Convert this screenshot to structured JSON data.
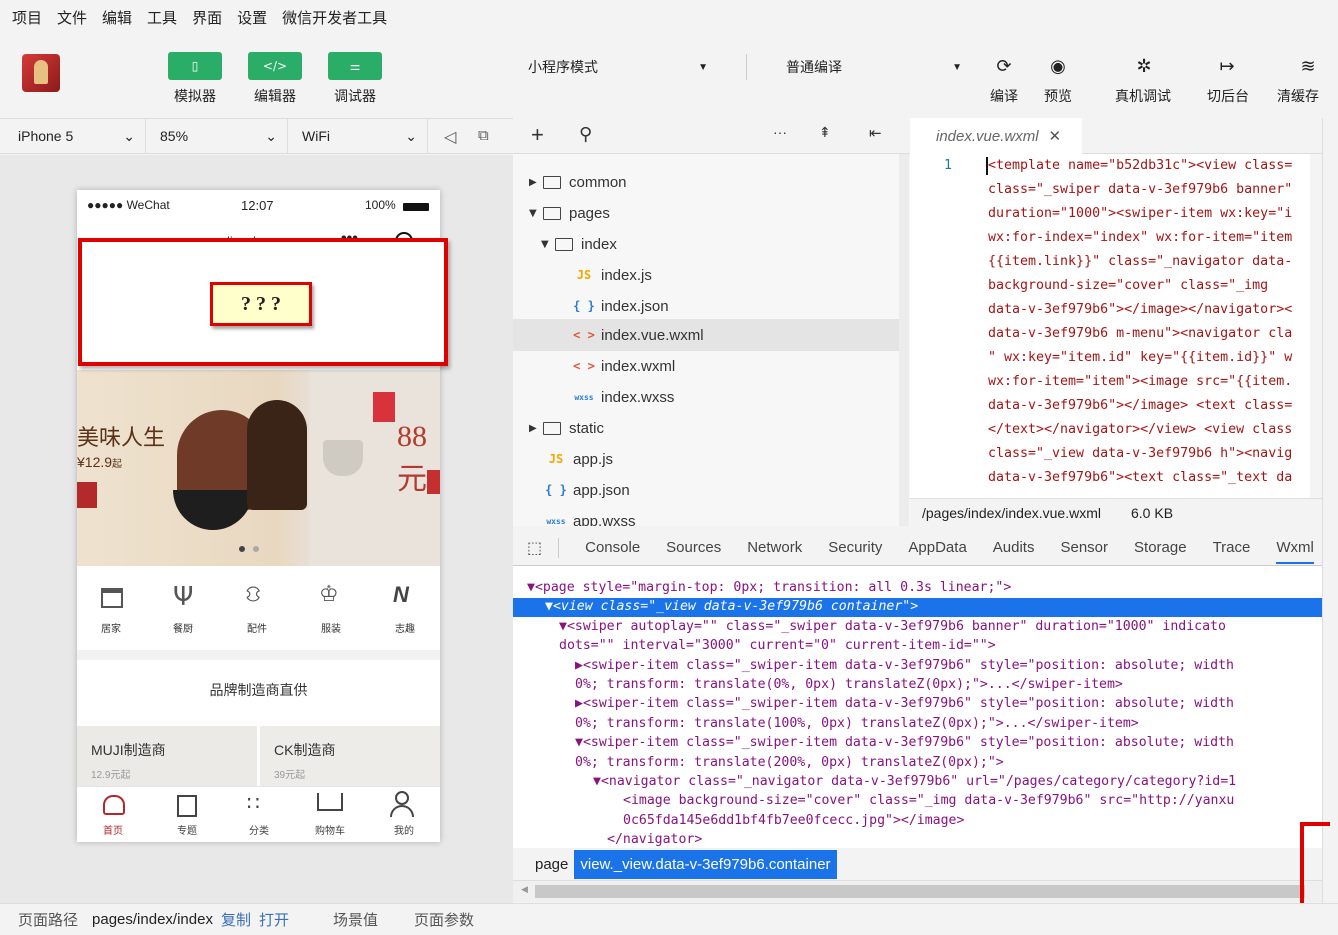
{
  "menu": [
    "项目",
    "文件",
    "编辑",
    "工具",
    "界面",
    "设置",
    "微信开发者工具"
  ],
  "toolbar": {
    "simulator": "模拟器",
    "editor": "编辑器",
    "debugger": "调试器",
    "mode_select": "小程序模式",
    "compile_select": "普通编译",
    "compile": "编译",
    "preview": "预览",
    "remote_debug": "真机调试",
    "background": "切后台",
    "clear_cache": "清缓存"
  },
  "device": {
    "model": "iPhone 5",
    "zoom": "85%",
    "network": "WiFi"
  },
  "phone": {
    "status_left": "●●●●● WeChat",
    "status_time": "12:07",
    "status_battery": "100%",
    "nav_title": "lis_shop",
    "nav_dots": "•••",
    "annotation": "? ? ?",
    "banner_text1": "美味人生",
    "banner_price": "¥12.9",
    "banner_price_suffix": "起",
    "banner_text2": "88元",
    "categories": [
      "居家",
      "餐厨",
      "配件",
      "服装",
      "志趣"
    ],
    "brand_title": "品牌制造商直供",
    "brands": [
      {
        "name": "MUJI制造商",
        "price": "12.9元起"
      },
      {
        "name": "CK制造商",
        "price": "39元起"
      }
    ],
    "tabs": [
      "首页",
      "专题",
      "分类",
      "购物车",
      "我的"
    ]
  },
  "tree": {
    "items": [
      {
        "label": "common",
        "kind": "folder",
        "arrow": "▶"
      },
      {
        "label": "pages",
        "kind": "folder",
        "arrow": "▼"
      },
      {
        "label": "index",
        "kind": "folder",
        "arrow": "▼"
      },
      {
        "label": "index.js",
        "kind": "js",
        "icon": "JS"
      },
      {
        "label": "index.json",
        "kind": "json",
        "icon": "{ }"
      },
      {
        "label": "index.vue.wxml",
        "kind": "wxml",
        "icon": "< >"
      },
      {
        "label": "index.wxml",
        "kind": "wxml",
        "icon": "< >"
      },
      {
        "label": "index.wxss",
        "kind": "wxss",
        "icon": "wxss"
      },
      {
        "label": "static",
        "kind": "folder",
        "arrow": "▶"
      },
      {
        "label": "app.js",
        "kind": "js",
        "icon": "JS"
      },
      {
        "label": "app.json",
        "kind": "json",
        "icon": "{ }"
      },
      {
        "label": "app.wxss",
        "kind": "wxss",
        "icon": "wxss"
      }
    ]
  },
  "editor": {
    "tab": "index.vue.wxml",
    "line_number": "1",
    "lines": [
      "<template name=\"b52db31c\"><view class=",
      "class=\"_swiper data-v-3ef979b6 banner\"",
      "duration=\"1000\"><swiper-item wx:key=\"i",
      "wx:for-index=\"index\" wx:for-item=\"item",
      "{{item.link}}\" class=\"_navigator data-",
      "background-size=\"cover\" class=\"_img",
      "data-v-3ef979b6\"></image></navigator><",
      "data-v-3ef979b6 m-menu\"><navigator cla",
      "\" wx:key=\"item.id\" key=\"{{item.id}}\" w",
      "wx:for-item=\"item\"><image src=\"{{item.",
      "data-v-3ef979b6\"></image> <text class=",
      "</text></navigator></view> <view class",
      "class=\"_view data-v-3ef979b6 h\"><navig",
      "data-v-3ef979b6\"><text class=\"_text da"
    ],
    "path": "/pages/index/index.vue.wxml",
    "size": "6.0 KB"
  },
  "devtools": {
    "tabs": [
      "Console",
      "Sources",
      "Network",
      "Security",
      "AppData",
      "Audits",
      "Sensor",
      "Storage",
      "Trace",
      "Wxml"
    ],
    "dom": [
      "▼<page style=\"margin-top: 0px; transition: all 0.3s linear;\">",
      "▼<view class=\"_view data-v-3ef979b6 container\">",
      "▼<swiper autoplay=\"\" class=\"_swiper data-v-3ef979b6 banner\" duration=\"1000\" indicato",
      "dots=\"\" interval=\"3000\" current=\"0\" current-item-id=\"\">",
      "▶<swiper-item class=\"_swiper-item data-v-3ef979b6\" style=\"position: absolute; width",
      "0%; transform: translate(0%, 0px) translateZ(0px);\">...</swiper-item>",
      "▶<swiper-item class=\"_swiper-item data-v-3ef979b6\" style=\"position: absolute; width",
      "0%; transform: translate(100%, 0px) translateZ(0px);\">...</swiper-item>",
      "▼<swiper-item class=\"_swiper-item data-v-3ef979b6\" style=\"position: absolute; width",
      "0%; transform: translate(200%, 0px) translateZ(0px);\">",
      "▼<navigator class=\"_navigator data-v-3ef979b6\" url=\"/pages/category/category?id=1",
      "<image background-size=\"cover\" class=\"_img data-v-3ef979b6\" src=\"http://yanxu",
      "0c65fda145e6dd1bf4fb7ee0fcecc.jpg\"></image>",
      "</navigator>"
    ],
    "crumb_page": "page",
    "crumb_selected": "view._view.data-v-3ef979b6.container"
  },
  "statusbar": {
    "path_label": "页面路径",
    "path": "pages/index/index",
    "copy": "复制",
    "open": "打开",
    "scene": "场景值",
    "params": "页面参数"
  },
  "colors": {
    "green": "#2aae67",
    "selection": "#1a73e8",
    "annotation_border": "#e00000",
    "annotation_fill": "#ffffcc"
  }
}
